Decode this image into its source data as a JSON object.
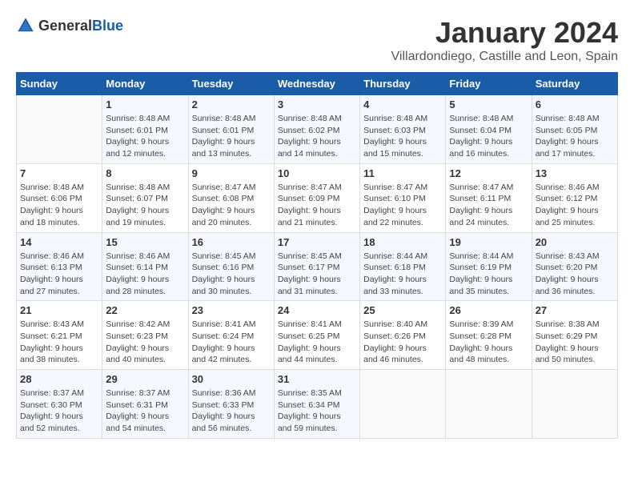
{
  "header": {
    "logo_general": "General",
    "logo_blue": "Blue",
    "month": "January 2024",
    "location": "Villardondiego, Castille and Leon, Spain"
  },
  "weekdays": [
    "Sunday",
    "Monday",
    "Tuesday",
    "Wednesday",
    "Thursday",
    "Friday",
    "Saturday"
  ],
  "weeks": [
    [
      {
        "day": "",
        "info": ""
      },
      {
        "day": "1",
        "info": "Sunrise: 8:48 AM\nSunset: 6:01 PM\nDaylight: 9 hours\nand 12 minutes."
      },
      {
        "day": "2",
        "info": "Sunrise: 8:48 AM\nSunset: 6:01 PM\nDaylight: 9 hours\nand 13 minutes."
      },
      {
        "day": "3",
        "info": "Sunrise: 8:48 AM\nSunset: 6:02 PM\nDaylight: 9 hours\nand 14 minutes."
      },
      {
        "day": "4",
        "info": "Sunrise: 8:48 AM\nSunset: 6:03 PM\nDaylight: 9 hours\nand 15 minutes."
      },
      {
        "day": "5",
        "info": "Sunrise: 8:48 AM\nSunset: 6:04 PM\nDaylight: 9 hours\nand 16 minutes."
      },
      {
        "day": "6",
        "info": "Sunrise: 8:48 AM\nSunset: 6:05 PM\nDaylight: 9 hours\nand 17 minutes."
      }
    ],
    [
      {
        "day": "7",
        "info": "Sunrise: 8:48 AM\nSunset: 6:06 PM\nDaylight: 9 hours\nand 18 minutes."
      },
      {
        "day": "8",
        "info": "Sunrise: 8:48 AM\nSunset: 6:07 PM\nDaylight: 9 hours\nand 19 minutes."
      },
      {
        "day": "9",
        "info": "Sunrise: 8:47 AM\nSunset: 6:08 PM\nDaylight: 9 hours\nand 20 minutes."
      },
      {
        "day": "10",
        "info": "Sunrise: 8:47 AM\nSunset: 6:09 PM\nDaylight: 9 hours\nand 21 minutes."
      },
      {
        "day": "11",
        "info": "Sunrise: 8:47 AM\nSunset: 6:10 PM\nDaylight: 9 hours\nand 22 minutes."
      },
      {
        "day": "12",
        "info": "Sunrise: 8:47 AM\nSunset: 6:11 PM\nDaylight: 9 hours\nand 24 minutes."
      },
      {
        "day": "13",
        "info": "Sunrise: 8:46 AM\nSunset: 6:12 PM\nDaylight: 9 hours\nand 25 minutes."
      }
    ],
    [
      {
        "day": "14",
        "info": "Sunrise: 8:46 AM\nSunset: 6:13 PM\nDaylight: 9 hours\nand 27 minutes."
      },
      {
        "day": "15",
        "info": "Sunrise: 8:46 AM\nSunset: 6:14 PM\nDaylight: 9 hours\nand 28 minutes."
      },
      {
        "day": "16",
        "info": "Sunrise: 8:45 AM\nSunset: 6:16 PM\nDaylight: 9 hours\nand 30 minutes."
      },
      {
        "day": "17",
        "info": "Sunrise: 8:45 AM\nSunset: 6:17 PM\nDaylight: 9 hours\nand 31 minutes."
      },
      {
        "day": "18",
        "info": "Sunrise: 8:44 AM\nSunset: 6:18 PM\nDaylight: 9 hours\nand 33 minutes."
      },
      {
        "day": "19",
        "info": "Sunrise: 8:44 AM\nSunset: 6:19 PM\nDaylight: 9 hours\nand 35 minutes."
      },
      {
        "day": "20",
        "info": "Sunrise: 8:43 AM\nSunset: 6:20 PM\nDaylight: 9 hours\nand 36 minutes."
      }
    ],
    [
      {
        "day": "21",
        "info": "Sunrise: 8:43 AM\nSunset: 6:21 PM\nDaylight: 9 hours\nand 38 minutes."
      },
      {
        "day": "22",
        "info": "Sunrise: 8:42 AM\nSunset: 6:23 PM\nDaylight: 9 hours\nand 40 minutes."
      },
      {
        "day": "23",
        "info": "Sunrise: 8:41 AM\nSunset: 6:24 PM\nDaylight: 9 hours\nand 42 minutes."
      },
      {
        "day": "24",
        "info": "Sunrise: 8:41 AM\nSunset: 6:25 PM\nDaylight: 9 hours\nand 44 minutes."
      },
      {
        "day": "25",
        "info": "Sunrise: 8:40 AM\nSunset: 6:26 PM\nDaylight: 9 hours\nand 46 minutes."
      },
      {
        "day": "26",
        "info": "Sunrise: 8:39 AM\nSunset: 6:28 PM\nDaylight: 9 hours\nand 48 minutes."
      },
      {
        "day": "27",
        "info": "Sunrise: 8:38 AM\nSunset: 6:29 PM\nDaylight: 9 hours\nand 50 minutes."
      }
    ],
    [
      {
        "day": "28",
        "info": "Sunrise: 8:37 AM\nSunset: 6:30 PM\nDaylight: 9 hours\nand 52 minutes."
      },
      {
        "day": "29",
        "info": "Sunrise: 8:37 AM\nSunset: 6:31 PM\nDaylight: 9 hours\nand 54 minutes."
      },
      {
        "day": "30",
        "info": "Sunrise: 8:36 AM\nSunset: 6:33 PM\nDaylight: 9 hours\nand 56 minutes."
      },
      {
        "day": "31",
        "info": "Sunrise: 8:35 AM\nSunset: 6:34 PM\nDaylight: 9 hours\nand 59 minutes."
      },
      {
        "day": "",
        "info": ""
      },
      {
        "day": "",
        "info": ""
      },
      {
        "day": "",
        "info": ""
      }
    ]
  ]
}
